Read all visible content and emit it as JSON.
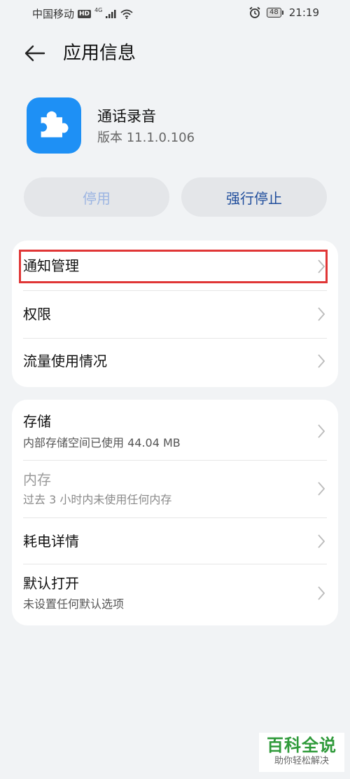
{
  "status_bar": {
    "carrier": "中国移动",
    "hd": "HD",
    "network": "4G",
    "battery": "48",
    "time": "21:19"
  },
  "header": {
    "title": "应用信息"
  },
  "app": {
    "name": "通话录音",
    "version": "版本 11.1.0.106",
    "icon": "puzzle-icon",
    "icon_color": "#1e90f5"
  },
  "actions": {
    "disable_label": "停用",
    "force_stop_label": "强行停止"
  },
  "section1": {
    "items": [
      {
        "label": "通知管理"
      },
      {
        "label": "权限"
      },
      {
        "label": "流量使用情况"
      }
    ]
  },
  "section2": {
    "items": [
      {
        "label": "存储",
        "sub": "内部存储空间已使用 44.04 MB"
      },
      {
        "label": "内存",
        "sub": "过去 3 小时内未使用任何内存"
      },
      {
        "label": "耗电详情"
      },
      {
        "label": "默认打开",
        "sub": "未设置任何默认选项"
      }
    ]
  },
  "watermark": {
    "main": "百科全说",
    "sub": "助你轻松解决"
  },
  "colors": {
    "highlight": "#e03636",
    "accent": "#1f4d9c"
  }
}
